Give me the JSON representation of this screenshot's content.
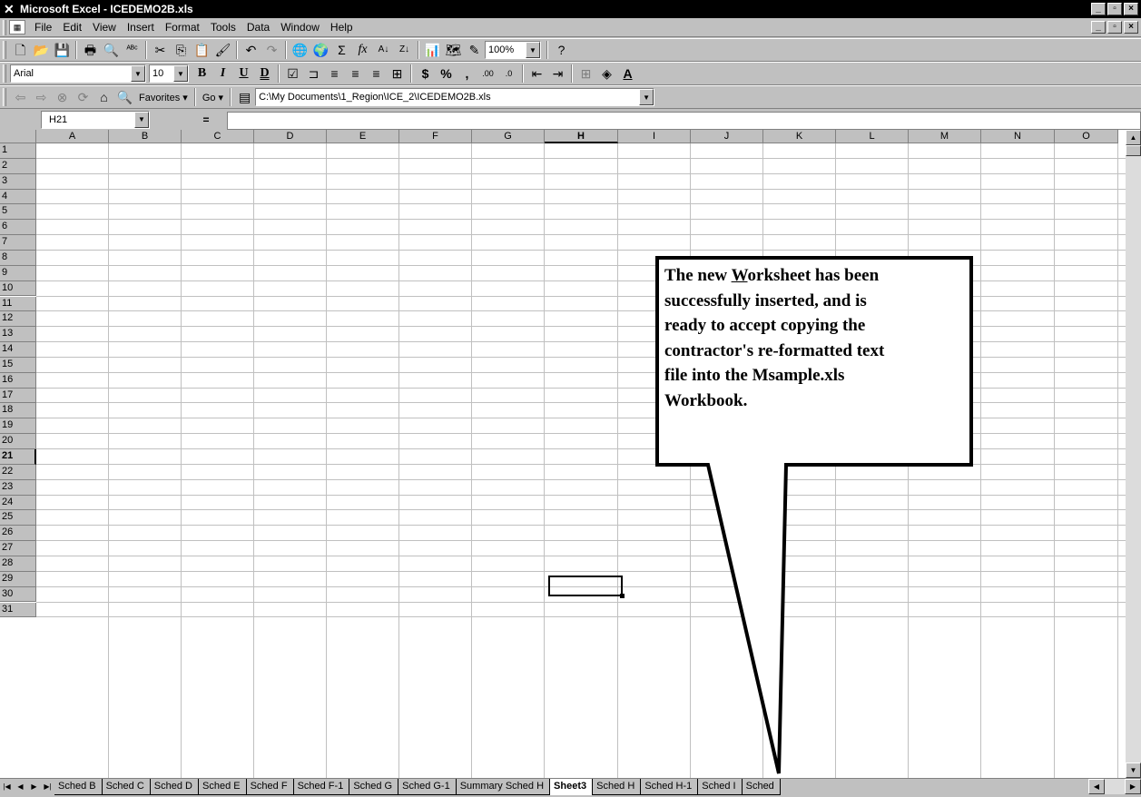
{
  "window": {
    "title": "Microsoft Excel - ICEDEMO2B.xls",
    "min_icon": "minimize-icon",
    "max_icon": "restore-icon",
    "close_icon": "close-icon"
  },
  "menu": {
    "items": [
      "File",
      "Edit",
      "View",
      "Insert",
      "Format",
      "Tools",
      "Data",
      "Window",
      "Help"
    ]
  },
  "standard_toolbar": {
    "zoom": "100%"
  },
  "formatting_toolbar": {
    "font": "Arial",
    "size": "10"
  },
  "web_toolbar": {
    "favorites": "Favorites ▾",
    "go": "Go ▾",
    "address": "C:\\My Documents\\1_Region\\ICE_2\\ICEDEMO2B.xls"
  },
  "formula_bar": {
    "name_box": "H21",
    "equals": "="
  },
  "grid": {
    "columns": [
      "A",
      "B",
      "C",
      "D",
      "E",
      "F",
      "G",
      "H",
      "I",
      "J",
      "K",
      "L",
      "M",
      "N",
      "O"
    ],
    "rows": [
      "1",
      "2",
      "3",
      "4",
      "5",
      "6",
      "7",
      "8",
      "9",
      "10",
      "11",
      "12",
      "13",
      "14",
      "15",
      "16",
      "17",
      "18",
      "19",
      "20",
      "21",
      "22",
      "23",
      "24",
      "25",
      "26",
      "27",
      "28",
      "29",
      "30",
      "31"
    ],
    "active_col": "H",
    "active_row": "21"
  },
  "sheet_tabs": [
    "Sched B",
    "Sched C",
    "Sched D",
    "Sched E",
    "Sched F",
    "Sched F-1",
    "Sched G",
    "Sched G-1",
    "Summary Sched H",
    "Sheet3",
    "Sched H",
    "Sched H-1",
    "Sched I",
    "Sched"
  ],
  "active_tab": "Sheet3",
  "callout": {
    "lines": [
      "The new Worksheet has been",
      "successfully inserted, and is",
      "ready to accept copying the",
      "contractor's re-formatted text",
      "file into the Msample.xls",
      "Workbook."
    ]
  }
}
